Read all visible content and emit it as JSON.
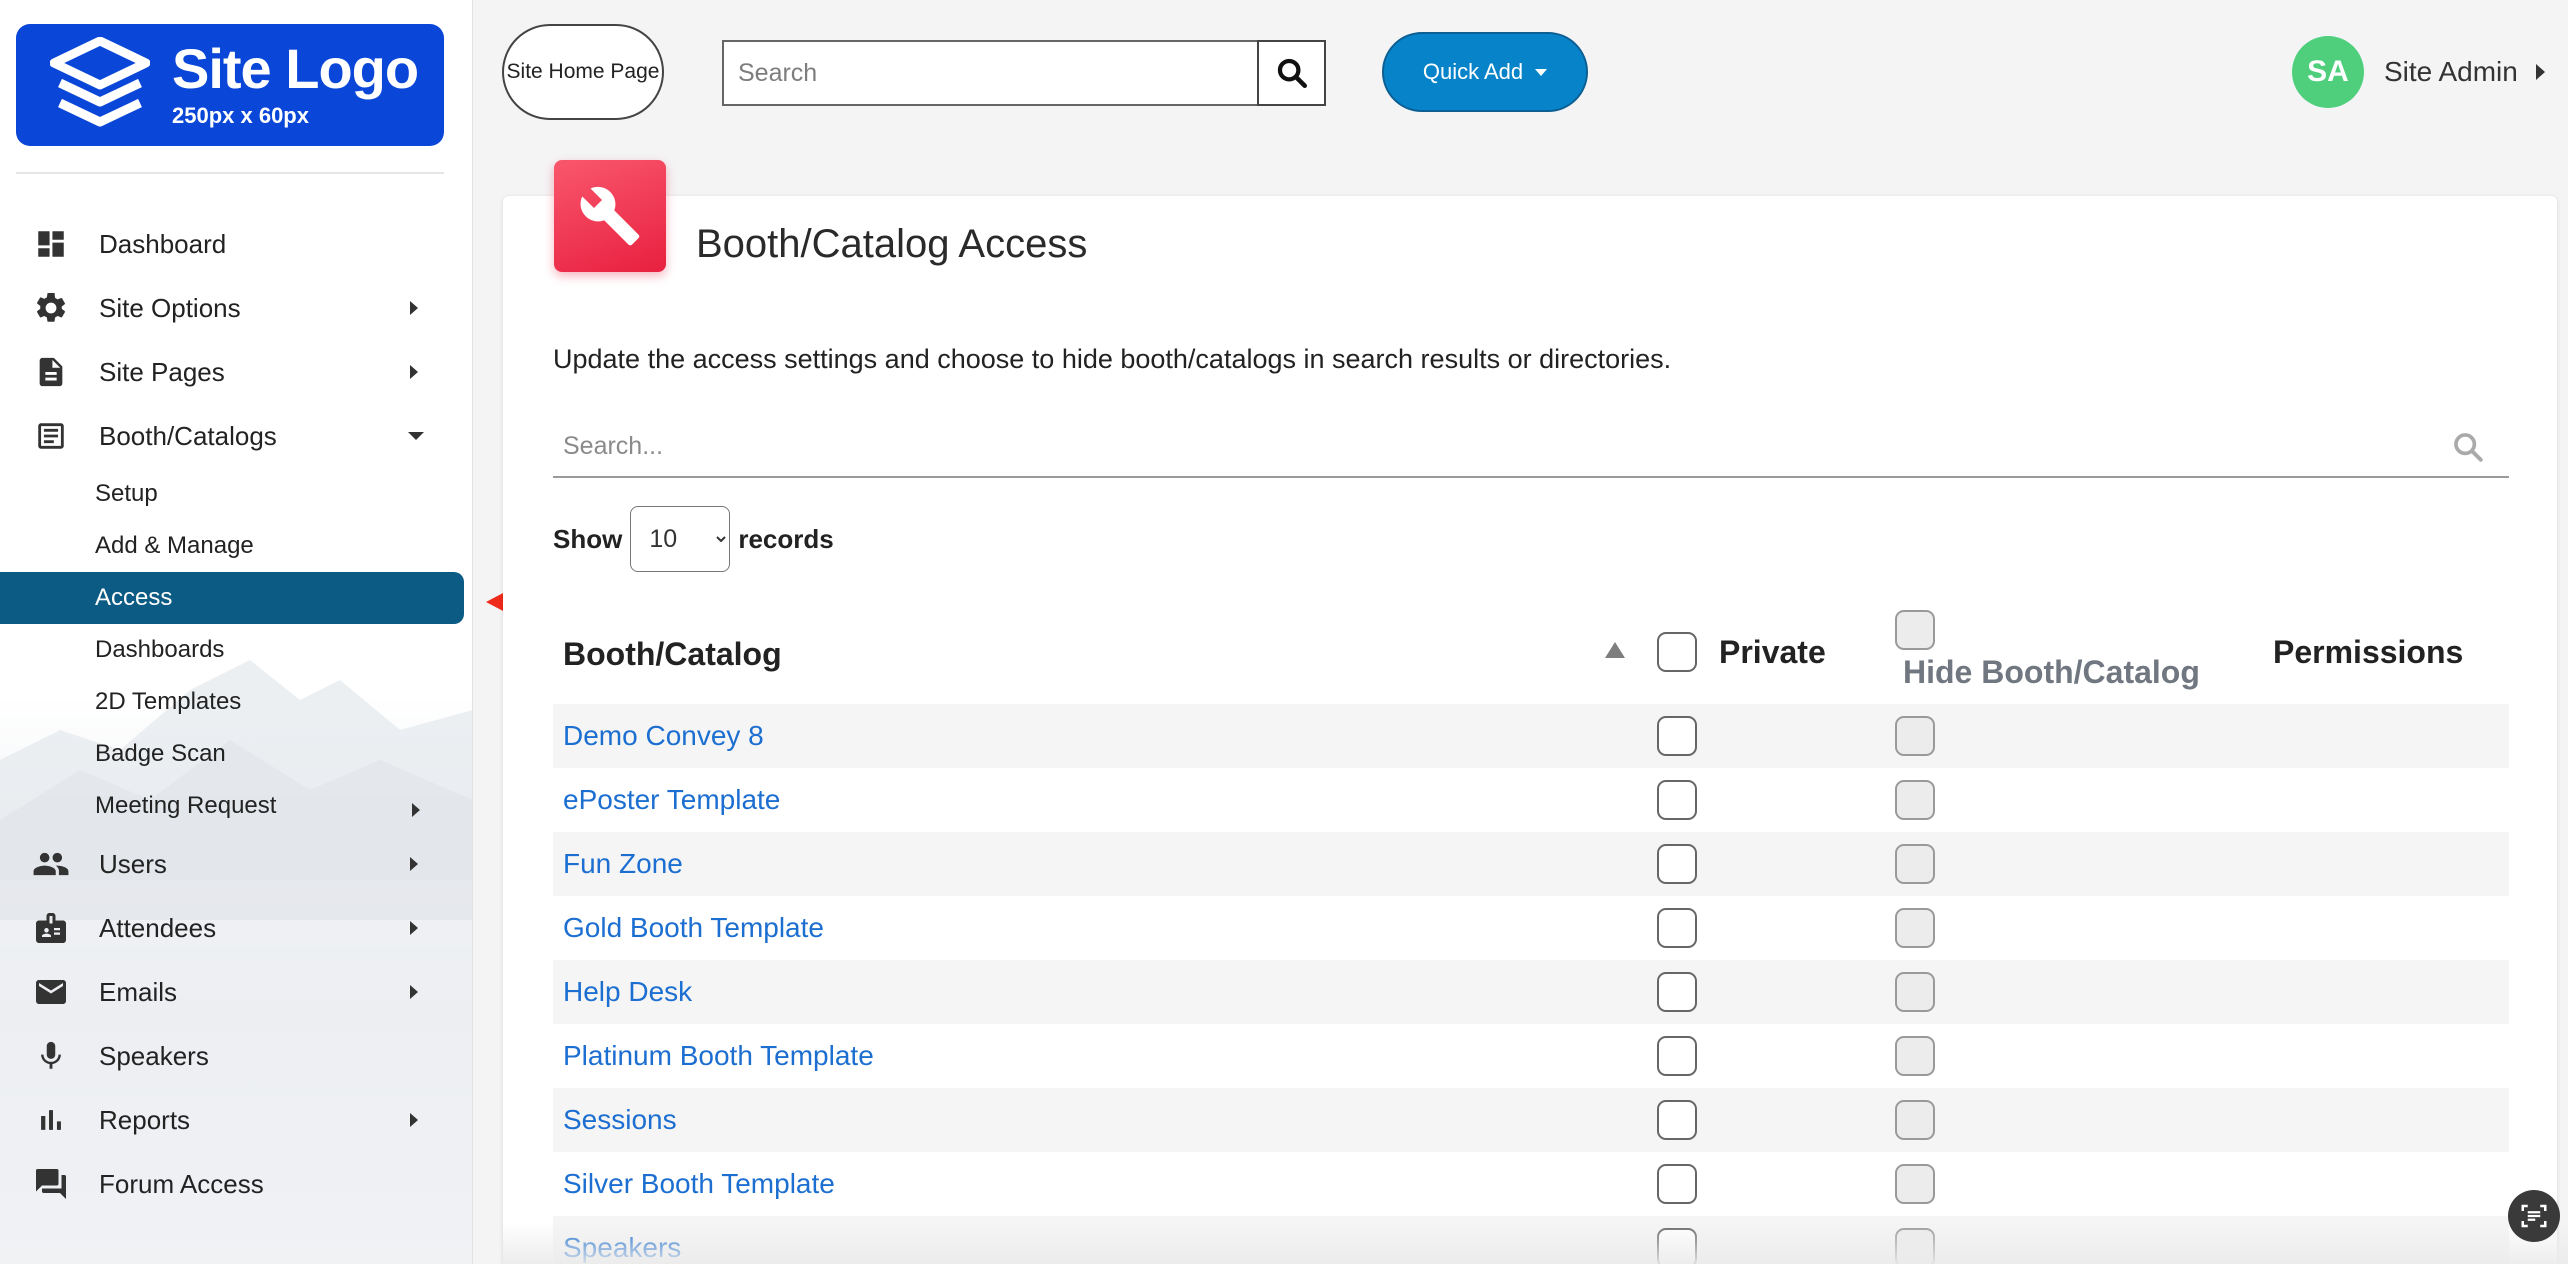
{
  "logo": {
    "title": "Site Logo",
    "subtitle": "250px x 60px"
  },
  "header": {
    "home_button": "Site Home Page",
    "search_placeholder": "Search",
    "quick_add": "Quick Add",
    "user_initials": "SA",
    "user_name": "Site Admin"
  },
  "sidebar": {
    "items": [
      {
        "label": "Dashboard",
        "icon": "dashboard-icon"
      },
      {
        "label": "Site Options",
        "icon": "gear-icon",
        "has_submenu": true
      },
      {
        "label": "Site Pages",
        "icon": "document-icon",
        "has_submenu": true
      },
      {
        "label": "Booth/Catalogs",
        "icon": "booth-icon",
        "expanded": true
      },
      {
        "label": "Users",
        "icon": "users-icon",
        "has_submenu": true
      },
      {
        "label": "Attendees",
        "icon": "badge-icon",
        "has_submenu": true
      },
      {
        "label": "Emails",
        "icon": "mail-icon",
        "has_submenu": true
      },
      {
        "label": "Speakers",
        "icon": "microphone-icon"
      },
      {
        "label": "Reports",
        "icon": "bar-chart-icon",
        "has_submenu": true
      },
      {
        "label": "Forum Access",
        "icon": "forum-icon"
      }
    ],
    "booth_submenu": [
      {
        "label": "Setup"
      },
      {
        "label": "Add & Manage"
      },
      {
        "label": "Access",
        "active": true
      },
      {
        "label": "Dashboards"
      },
      {
        "label": "2D Templates"
      },
      {
        "label": "Badge Scan"
      },
      {
        "label": "Meeting Request",
        "has_submenu": true
      }
    ]
  },
  "page": {
    "title": "Booth/Catalog Access",
    "description": "Update the access settings and choose to hide booth/catalogs in search results or directories.",
    "filter_placeholder": "Search...",
    "show_label": "Show",
    "records_label": "records",
    "page_size": "10"
  },
  "table": {
    "columns": {
      "booth": "Booth/Catalog",
      "private": "Private",
      "hide": "Hide Booth/Catalog",
      "permissions": "Permissions"
    },
    "rows": [
      {
        "name": "Demo Convey 8",
        "private": false,
        "hide": false
      },
      {
        "name": "ePoster Template",
        "private": false,
        "hide": false
      },
      {
        "name": "Fun Zone",
        "private": false,
        "hide": false
      },
      {
        "name": "Gold Booth Template",
        "private": false,
        "hide": false
      },
      {
        "name": "Help Desk",
        "private": false,
        "hide": false
      },
      {
        "name": "Platinum Booth Template",
        "private": false,
        "hide": false
      },
      {
        "name": "Sessions",
        "private": false,
        "hide": false
      },
      {
        "name": "Silver Booth Template",
        "private": false,
        "hide": false
      },
      {
        "name": "Speakers",
        "private": false,
        "hide": false
      }
    ]
  },
  "colors": {
    "logo_bg": "#0a47d8",
    "active_nav": "#0c5b85",
    "quick_add": "#0784c9",
    "avatar": "#4fcf7c",
    "link": "#1c6fd1",
    "page_icon": "#f0334f",
    "annotation_arrow": "#f02a1a"
  }
}
